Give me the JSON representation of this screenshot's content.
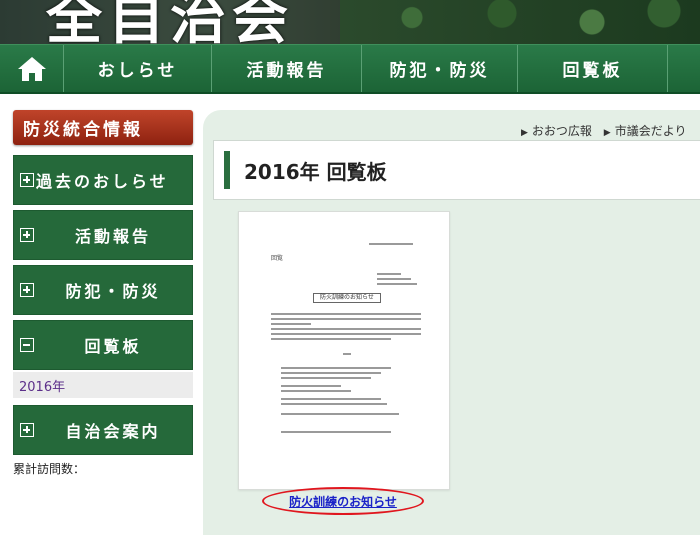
{
  "header": {
    "site_title": "全自治会"
  },
  "nav": {
    "home_icon": "home-icon",
    "items": [
      {
        "label": "おしらせ"
      },
      {
        "label": "活動報告"
      },
      {
        "label": "防犯・防災"
      },
      {
        "label": "回覧板"
      }
    ]
  },
  "sidebar": {
    "header": "防災統合情報",
    "items": [
      {
        "label": "過去のおしらせ",
        "state": "collapsed"
      },
      {
        "label": "活動報告",
        "state": "collapsed"
      },
      {
        "label": "防犯・防災",
        "state": "collapsed"
      },
      {
        "label": "回覧板",
        "state": "expanded"
      },
      {
        "label": "自治会案内",
        "state": "collapsed"
      }
    ],
    "sub_items": [
      {
        "label": "2016年"
      }
    ],
    "counter_label": "累計訪問数："
  },
  "top_links": [
    {
      "label": "おおつ広報"
    },
    {
      "label": "市議会だより"
    }
  ],
  "page": {
    "title": "2016年 回覧板",
    "document": {
      "tag": "回覧",
      "heading": "防火訓練のお知らせ",
      "caption": "防火訓練のお知らせ"
    }
  },
  "colors": {
    "nav_green": "#1f6a3b",
    "sidebar_green": "#25693a",
    "header_red": "#a8321b",
    "main_bg": "#e4efe6",
    "highlight_red": "#e0161e",
    "link_blue": "#1a22c8"
  }
}
